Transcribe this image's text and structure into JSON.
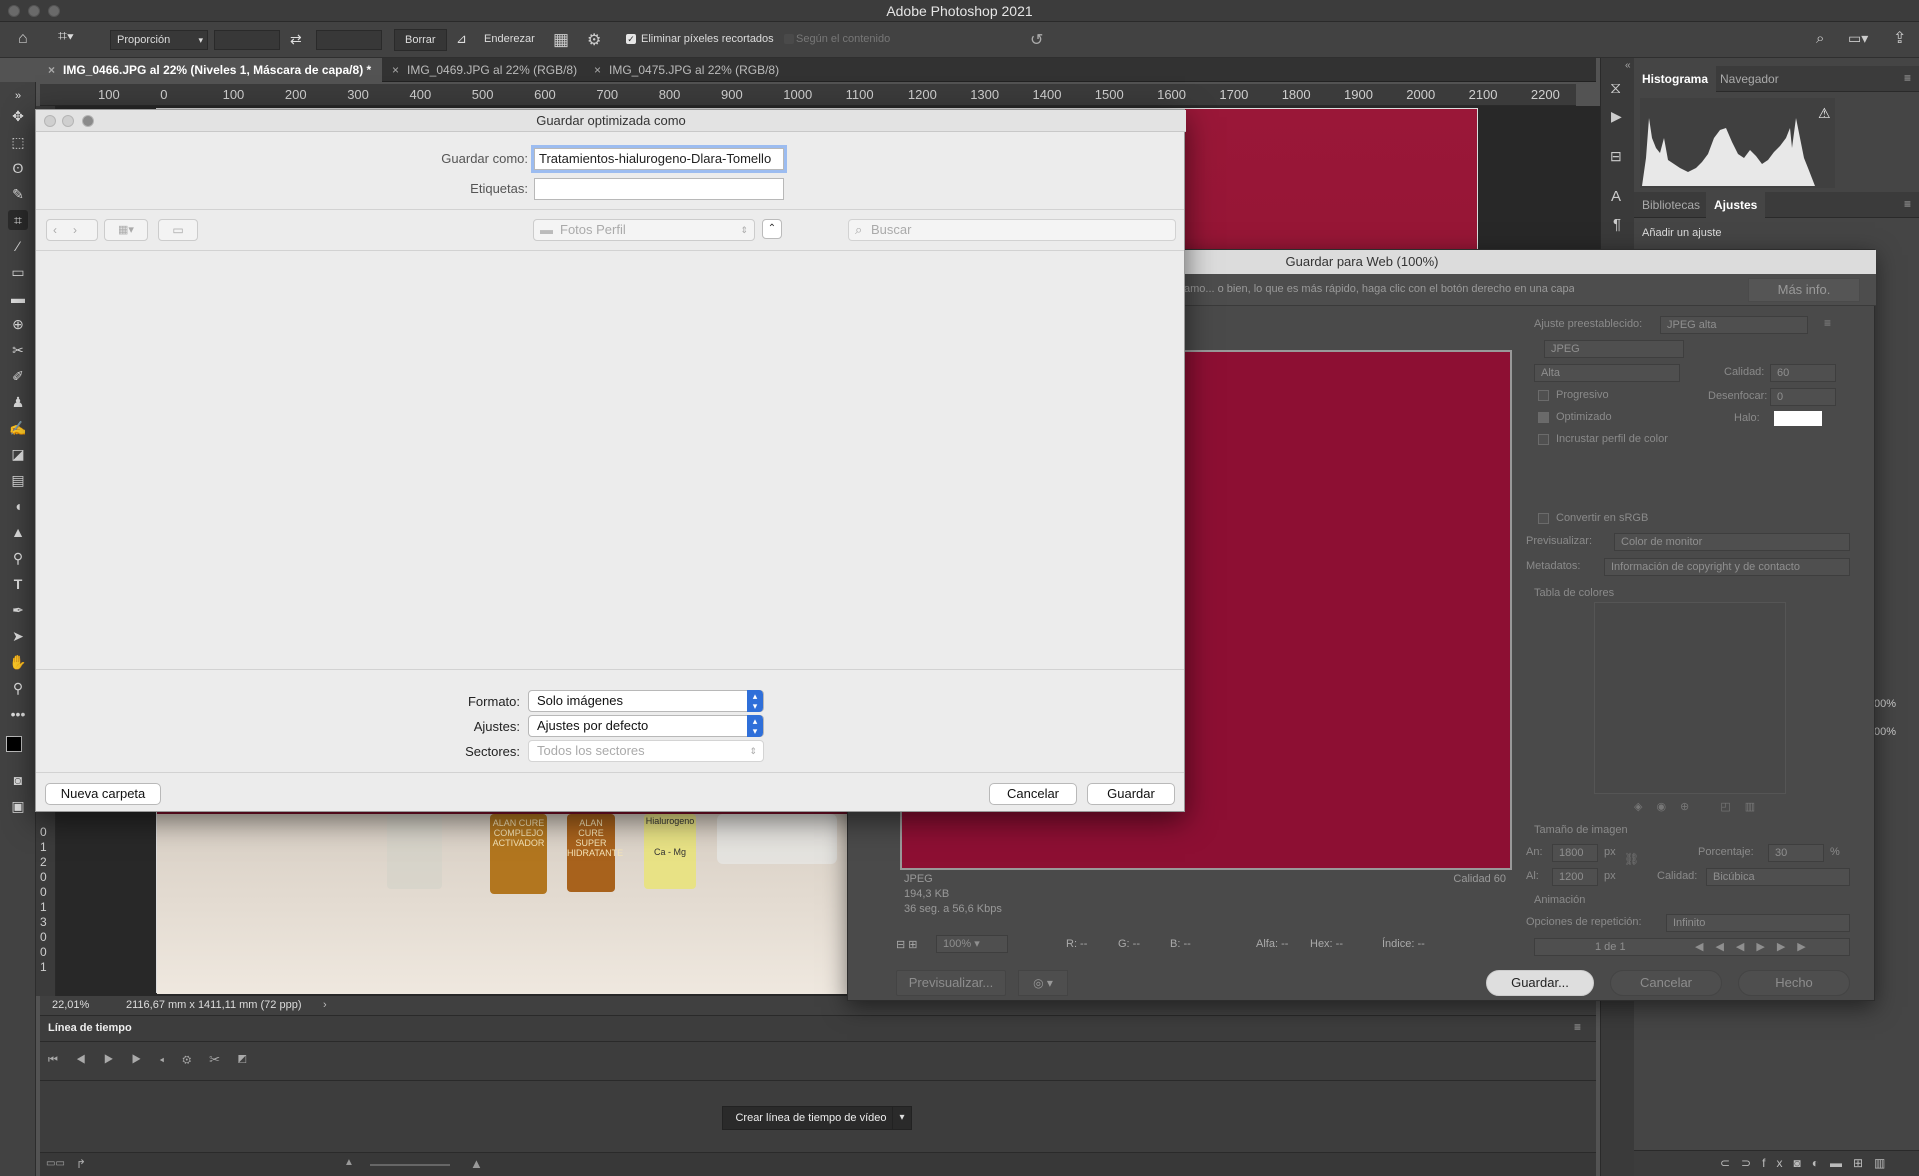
{
  "app": {
    "title": "Adobe Photoshop 2021"
  },
  "options": {
    "ratio": "Proporción",
    "clear": "Borrar",
    "straighten": "Enderezar",
    "delete_cropped": "Eliminar píxeles recortados",
    "content_aware": "Según el contenido"
  },
  "tabs": [
    {
      "label": "IMG_0466.JPG al 22% (Niveles 1, Máscara de capa/8) *"
    },
    {
      "label": "IMG_0469.JPG al 22% (RGB/8)"
    },
    {
      "label": "IMG_0475.JPG al 22% (RGB/8)"
    }
  ],
  "ruler": {
    "h": [
      "100",
      "0",
      "100",
      "200",
      "300",
      "400",
      "500",
      "600",
      "700",
      "800",
      "900",
      "1000",
      "1100",
      "1200",
      "1300",
      "1400",
      "1500",
      "1600",
      "1700",
      "1800",
      "1900",
      "2000",
      "2100",
      "2200"
    ],
    "v": [
      "0",
      "1",
      "2",
      "0",
      "0",
      "1",
      "3",
      "0",
      "0",
      "1"
    ]
  },
  "panels": {
    "histogram_tab": "Histograma",
    "navigator_tab": "Navegador",
    "libraries_tab": "Bibliotecas",
    "adjustments_tab": "Ajustes",
    "add_adjustment": "Añadir un ajuste",
    "zoom1": "00%",
    "zoom2": "00%"
  },
  "save_dialog": {
    "title": "Guardar optimizada como",
    "save_as_label": "Guardar como:",
    "save_as_value": "Tratamientos-hialurogeno-Dlara-Tomello",
    "tags_label": "Etiquetas:",
    "folder": "Fotos Perfil",
    "search_placeholder": "Buscar",
    "format_label": "Formato:",
    "format_value": "Solo imágenes",
    "settings_label": "Ajustes:",
    "settings_value": "Ajustes por defecto",
    "slices_label": "Sectores:",
    "slices_value": "Todos los sectores",
    "new_folder": "Nueva carpeta",
    "cancel": "Cancelar",
    "save": "Guardar"
  },
  "sfw": {
    "title": "Guardar para Web (100%)",
    "hint": "amo... o bien, lo que es más rápido, haga clic con el botón derecho en una capa para exportar los recursos",
    "more_info": "Más info.",
    "preset_label": "Ajuste preestablecido:",
    "preset_value": "JPEG alta",
    "format_value": "JPEG",
    "quality_level": "Alta",
    "quality_label": "Calidad:",
    "quality_value": "60",
    "progressive": "Progresivo",
    "blur_label": "Desenfocar:",
    "blur_value": "0",
    "optimized": "Optimizado",
    "matte_label": "Halo:",
    "embed_profile": "Incrustar perfil de color",
    "convert_srgb": "Convertir en sRGB",
    "preview_label": "Previsualizar:",
    "preview_value": "Color de monitor",
    "metadata_label": "Metadatos:",
    "metadata_value": "Información de copyright y de contacto",
    "color_table": "Tabla de colores",
    "image_size": "Tamaño de imagen",
    "width_label": "An:",
    "width_value": "1800",
    "height_label": "Al:",
    "height_value": "1200",
    "px": "px",
    "percent_label": "Porcentaje:",
    "percent_value": "30",
    "pct": "%",
    "quality_resample_label": "Calidad:",
    "quality_resample_value": "Bicúbica",
    "animation": "Animación",
    "loop_label": "Opciones de repetición:",
    "loop_value": "Infinito",
    "frame": "1 de 1",
    "file_format": "JPEG",
    "file_size": "194,3 KB",
    "download_time": "36 seg. a 56,6 Kbps",
    "quality_info": "Calidad 60",
    "zoom": "100%",
    "r": "R: --",
    "g": "G: --",
    "b": "B: --",
    "alpha": "Alfa: --",
    "hex": "Hex: --",
    "index": "Índice: --",
    "preview_btn": "Previsualizar...",
    "save_btn": "Guardar...",
    "cancel_btn": "Cancelar",
    "done_btn": "Hecho"
  },
  "status": {
    "zoom": "22,01%",
    "doc": "2116,67 mm x 1411,11 mm (72 ppp)"
  },
  "timeline": {
    "title": "Línea de tiempo",
    "create_button": "Crear línea de tiempo de vídeo"
  },
  "photo": {
    "labels": [
      "ALAN CURE COMPLEJO ACTIVADOR",
      "ALAN CURE SUPER HIDRATANTE",
      "Hialurogeno",
      "Ca - Mg"
    ]
  }
}
